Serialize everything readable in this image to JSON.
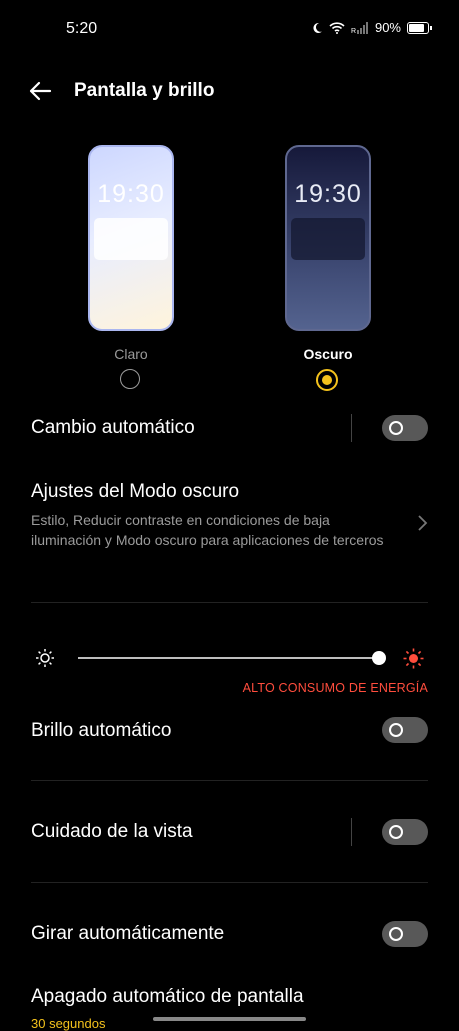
{
  "status": {
    "time": "5:20",
    "battery": "90%"
  },
  "header": {
    "title": "Pantalla y brillo"
  },
  "modes": {
    "light": {
      "label": "Claro",
      "clock": "19:30"
    },
    "dark": {
      "label": "Oscuro",
      "clock": "19:30",
      "selected": true
    }
  },
  "settings": {
    "auto_change": {
      "label": "Cambio automático",
      "enabled": false
    },
    "dark_mode_settings": {
      "label": "Ajustes del Modo oscuro",
      "description": "Estilo, Reducir contraste en condiciones de baja iluminación y Modo oscuro para aplicaciones de terceros"
    },
    "brightness": {
      "level": 1.0,
      "warning": "ALTO CONSUMO DE ENERGÍA"
    },
    "auto_brightness": {
      "label": "Brillo automático",
      "enabled": false
    },
    "eye_care": {
      "label": "Cuidado de la vista",
      "enabled": false
    },
    "auto_rotate": {
      "label": "Girar automáticamente",
      "enabled": false
    },
    "screen_timeout": {
      "label": "Apagado automático de pantalla",
      "value": "30 segundos"
    }
  },
  "colors": {
    "accent": "#f4c21c",
    "warning": "#ff4d3d",
    "toggle_off": "#585858"
  },
  "icons": [
    "moon-icon",
    "wifi-icon",
    "signal-icon",
    "battery-icon",
    "back-arrow-icon",
    "chevron-right-icon",
    "sun-low-icon",
    "sun-high-icon"
  ]
}
